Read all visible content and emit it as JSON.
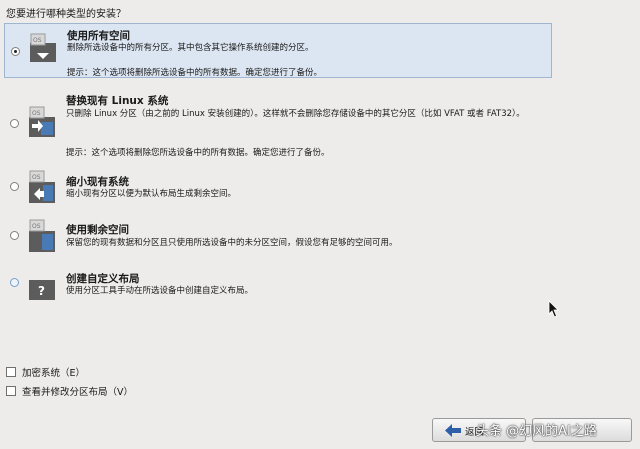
{
  "question": "您要进行哪种类型的安装？",
  "options": [
    {
      "title": "使用所有空间",
      "desc": "删除所选设备中的所有分区。其中包含其它操作系统创建的分区。",
      "tip": "提示：这个选项将删除所选设备中的所有数据。确定您进行了备份。",
      "icon_label": "OS",
      "selected": true
    },
    {
      "title": "替换现有 Linux 系统",
      "desc": "只删除 Linux 分区（由之前的 Linux 安装创建的）。这样就不会删除您存储设备中的其它分区（比如 VFAT 或者 FAT32）。",
      "tip": "提示：这个选项将删除您所选设备中的所有数据。确定您进行了备份。",
      "icon_label": "OS",
      "selected": false
    },
    {
      "title": "缩小现有系统",
      "desc": "缩小现有分区以便为默认布局生成剩余空间。",
      "icon_label": "OS",
      "selected": false
    },
    {
      "title": "使用剩余空间",
      "desc": "保留您的现有数据和分区且只使用所选设备中的未分区空间，假设您有足够的空间可用。",
      "icon_label": "OS",
      "selected": false
    },
    {
      "title": "创建自定义布局",
      "desc": "使用分区工具手动在所选设备中创建自定义布局。",
      "icon_label": "?",
      "selected": false
    }
  ],
  "checkboxes": [
    {
      "label": "加密系统（E）",
      "checked": false
    },
    {
      "label": "查看并修改分区布局（V）",
      "checked": false
    }
  ],
  "buttons": {
    "back_label": "返回"
  },
  "watermark": "头条 @幻风的AI之路",
  "colors": {
    "selected_bg": "#dce6f2",
    "icon_body": "#5a5a5a",
    "icon_blue": "#4a7ab5"
  }
}
